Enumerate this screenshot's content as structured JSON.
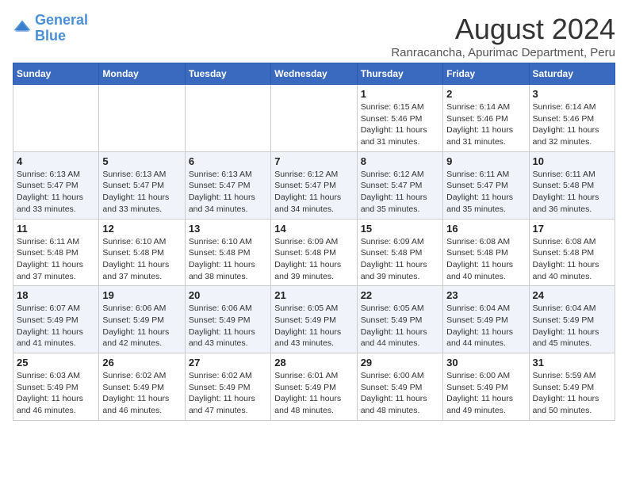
{
  "logo": {
    "line1": "General",
    "line2": "Blue"
  },
  "title": "August 2024",
  "subtitle": "Ranracancha, Apurimac Department, Peru",
  "weekdays": [
    "Sunday",
    "Monday",
    "Tuesday",
    "Wednesday",
    "Thursday",
    "Friday",
    "Saturday"
  ],
  "weeks": [
    [
      {
        "day": "",
        "info": ""
      },
      {
        "day": "",
        "info": ""
      },
      {
        "day": "",
        "info": ""
      },
      {
        "day": "",
        "info": ""
      },
      {
        "day": "1",
        "info": "Sunrise: 6:15 AM\nSunset: 5:46 PM\nDaylight: 11 hours\nand 31 minutes."
      },
      {
        "day": "2",
        "info": "Sunrise: 6:14 AM\nSunset: 5:46 PM\nDaylight: 11 hours\nand 31 minutes."
      },
      {
        "day": "3",
        "info": "Sunrise: 6:14 AM\nSunset: 5:46 PM\nDaylight: 11 hours\nand 32 minutes."
      }
    ],
    [
      {
        "day": "4",
        "info": "Sunrise: 6:13 AM\nSunset: 5:47 PM\nDaylight: 11 hours\nand 33 minutes."
      },
      {
        "day": "5",
        "info": "Sunrise: 6:13 AM\nSunset: 5:47 PM\nDaylight: 11 hours\nand 33 minutes."
      },
      {
        "day": "6",
        "info": "Sunrise: 6:13 AM\nSunset: 5:47 PM\nDaylight: 11 hours\nand 34 minutes."
      },
      {
        "day": "7",
        "info": "Sunrise: 6:12 AM\nSunset: 5:47 PM\nDaylight: 11 hours\nand 34 minutes."
      },
      {
        "day": "8",
        "info": "Sunrise: 6:12 AM\nSunset: 5:47 PM\nDaylight: 11 hours\nand 35 minutes."
      },
      {
        "day": "9",
        "info": "Sunrise: 6:11 AM\nSunset: 5:47 PM\nDaylight: 11 hours\nand 35 minutes."
      },
      {
        "day": "10",
        "info": "Sunrise: 6:11 AM\nSunset: 5:48 PM\nDaylight: 11 hours\nand 36 minutes."
      }
    ],
    [
      {
        "day": "11",
        "info": "Sunrise: 6:11 AM\nSunset: 5:48 PM\nDaylight: 11 hours\nand 37 minutes."
      },
      {
        "day": "12",
        "info": "Sunrise: 6:10 AM\nSunset: 5:48 PM\nDaylight: 11 hours\nand 37 minutes."
      },
      {
        "day": "13",
        "info": "Sunrise: 6:10 AM\nSunset: 5:48 PM\nDaylight: 11 hours\nand 38 minutes."
      },
      {
        "day": "14",
        "info": "Sunrise: 6:09 AM\nSunset: 5:48 PM\nDaylight: 11 hours\nand 39 minutes."
      },
      {
        "day": "15",
        "info": "Sunrise: 6:09 AM\nSunset: 5:48 PM\nDaylight: 11 hours\nand 39 minutes."
      },
      {
        "day": "16",
        "info": "Sunrise: 6:08 AM\nSunset: 5:48 PM\nDaylight: 11 hours\nand 40 minutes."
      },
      {
        "day": "17",
        "info": "Sunrise: 6:08 AM\nSunset: 5:48 PM\nDaylight: 11 hours\nand 40 minutes."
      }
    ],
    [
      {
        "day": "18",
        "info": "Sunrise: 6:07 AM\nSunset: 5:49 PM\nDaylight: 11 hours\nand 41 minutes."
      },
      {
        "day": "19",
        "info": "Sunrise: 6:06 AM\nSunset: 5:49 PM\nDaylight: 11 hours\nand 42 minutes."
      },
      {
        "day": "20",
        "info": "Sunrise: 6:06 AM\nSunset: 5:49 PM\nDaylight: 11 hours\nand 43 minutes."
      },
      {
        "day": "21",
        "info": "Sunrise: 6:05 AM\nSunset: 5:49 PM\nDaylight: 11 hours\nand 43 minutes."
      },
      {
        "day": "22",
        "info": "Sunrise: 6:05 AM\nSunset: 5:49 PM\nDaylight: 11 hours\nand 44 minutes."
      },
      {
        "day": "23",
        "info": "Sunrise: 6:04 AM\nSunset: 5:49 PM\nDaylight: 11 hours\nand 44 minutes."
      },
      {
        "day": "24",
        "info": "Sunrise: 6:04 AM\nSunset: 5:49 PM\nDaylight: 11 hours\nand 45 minutes."
      }
    ],
    [
      {
        "day": "25",
        "info": "Sunrise: 6:03 AM\nSunset: 5:49 PM\nDaylight: 11 hours\nand 46 minutes."
      },
      {
        "day": "26",
        "info": "Sunrise: 6:02 AM\nSunset: 5:49 PM\nDaylight: 11 hours\nand 46 minutes."
      },
      {
        "day": "27",
        "info": "Sunrise: 6:02 AM\nSunset: 5:49 PM\nDaylight: 11 hours\nand 47 minutes."
      },
      {
        "day": "28",
        "info": "Sunrise: 6:01 AM\nSunset: 5:49 PM\nDaylight: 11 hours\nand 48 minutes."
      },
      {
        "day": "29",
        "info": "Sunrise: 6:00 AM\nSunset: 5:49 PM\nDaylight: 11 hours\nand 48 minutes."
      },
      {
        "day": "30",
        "info": "Sunrise: 6:00 AM\nSunset: 5:49 PM\nDaylight: 11 hours\nand 49 minutes."
      },
      {
        "day": "31",
        "info": "Sunrise: 5:59 AM\nSunset: 5:49 PM\nDaylight: 11 hours\nand 50 minutes."
      }
    ]
  ]
}
